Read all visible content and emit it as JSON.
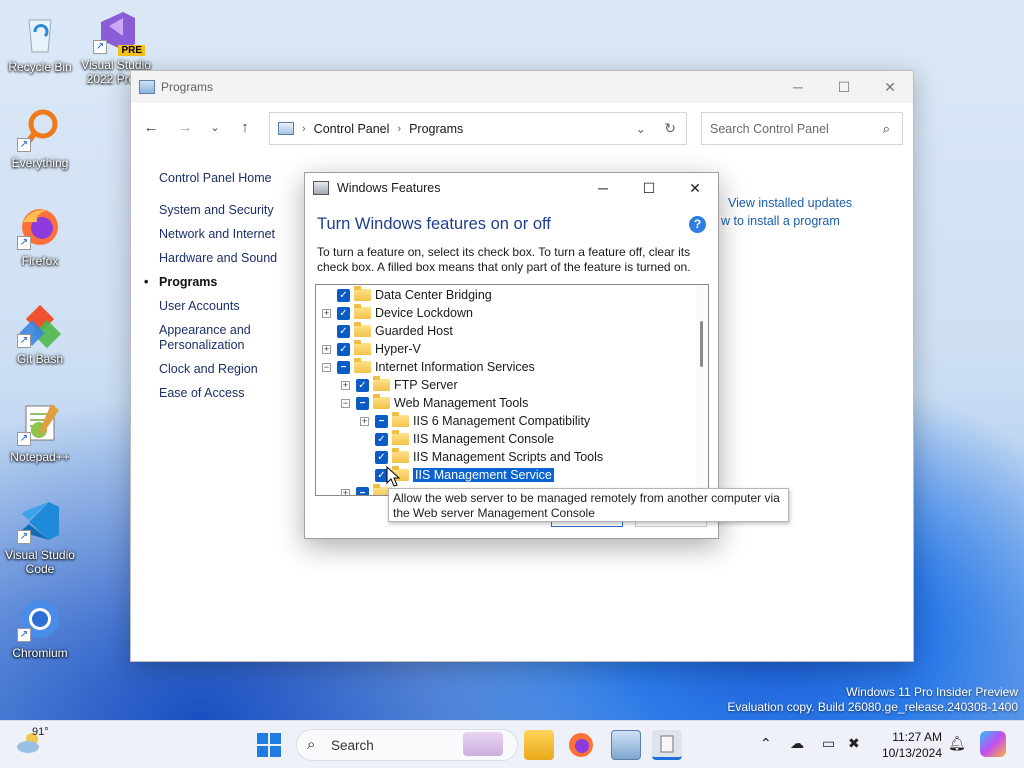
{
  "desktop": {
    "icons": [
      {
        "label": "Recycle Bin",
        "icon": "recycle-bin-icon"
      },
      {
        "label": "Visual Studio 2022 Pre...",
        "icon": "visual-studio-icon",
        "badge": "PRE"
      },
      {
        "label": "Everything",
        "icon": "search-magnifier-icon"
      },
      {
        "label": "Firefox",
        "icon": "firefox-icon"
      },
      {
        "label": "Git Bash",
        "icon": "git-icon"
      },
      {
        "label": "Notepad++",
        "icon": "notepadpp-icon"
      },
      {
        "label": "Visual Studio Code",
        "icon": "vscode-icon"
      },
      {
        "label": "Chromium",
        "icon": "chromium-icon"
      }
    ]
  },
  "explorer": {
    "title": "Programs",
    "address": {
      "crumbs": [
        "Control Panel",
        "Programs"
      ]
    },
    "search_placeholder": "Search Control Panel",
    "left_nav": {
      "home": "Control Panel Home",
      "items": [
        "System and Security",
        "Network and Internet",
        "Hardware and Sound",
        "Programs",
        "User Accounts",
        "Appearance and Personalization",
        "Clock and Region",
        "Ease of Access"
      ],
      "selected": "Programs"
    },
    "right_links": [
      "View installed updates",
      "w to install a program"
    ]
  },
  "dialog": {
    "title": "Windows Features",
    "heading": "Turn Windows features on or off",
    "description": "To turn a feature on, select its check box. To turn a feature off, clear its check box. A filled box means that only part of the feature is turned on.",
    "tree": [
      {
        "label": "Data Center Bridging",
        "level": 0,
        "expander": "",
        "state": "checked"
      },
      {
        "label": "Device Lockdown",
        "level": 0,
        "expander": "+",
        "state": "checked"
      },
      {
        "label": "Guarded Host",
        "level": 0,
        "expander": "",
        "state": "checked"
      },
      {
        "label": "Hyper-V",
        "level": 0,
        "expander": "+",
        "state": "checked"
      },
      {
        "label": "Internet Information Services",
        "level": 0,
        "expander": "-",
        "state": "partial"
      },
      {
        "label": "FTP Server",
        "level": 1,
        "expander": "+",
        "state": "checked"
      },
      {
        "label": "Web Management Tools",
        "level": 1,
        "expander": "-",
        "state": "partial"
      },
      {
        "label": "IIS 6 Management Compatibility",
        "level": 2,
        "expander": "+",
        "state": "partial"
      },
      {
        "label": "IIS Management Console",
        "level": 2,
        "expander": "",
        "state": "checked"
      },
      {
        "label": "IIS Management Scripts and Tools",
        "level": 2,
        "expander": "",
        "state": "checked"
      },
      {
        "label": "IIS Management Service",
        "level": 2,
        "expander": "",
        "state": "checked",
        "selected": true
      },
      {
        "label": "",
        "level": 1,
        "expander": "+",
        "state": "partial"
      }
    ],
    "tooltip": "Allow the web server to be managed remotely from another computer via the Web server Management Console"
  },
  "watermark": {
    "line1": "Windows 11 Pro Insider Preview",
    "line2": "Evaluation copy. Build 26080.ge_release.240308-1400"
  },
  "taskbar": {
    "weather_temp": "91°",
    "search_label": "Search",
    "clock_time": "11:27 AM",
    "clock_date": "10/13/2024",
    "apps": [
      "file-explorer-icon",
      "firefox-icon",
      "control-panel-icon",
      "windows-features-icon"
    ]
  },
  "colors": {
    "accent": "#0b5bc4",
    "selection": "#0a63d1",
    "heading": "#1f3e8d",
    "link": "#1a5fb0"
  }
}
